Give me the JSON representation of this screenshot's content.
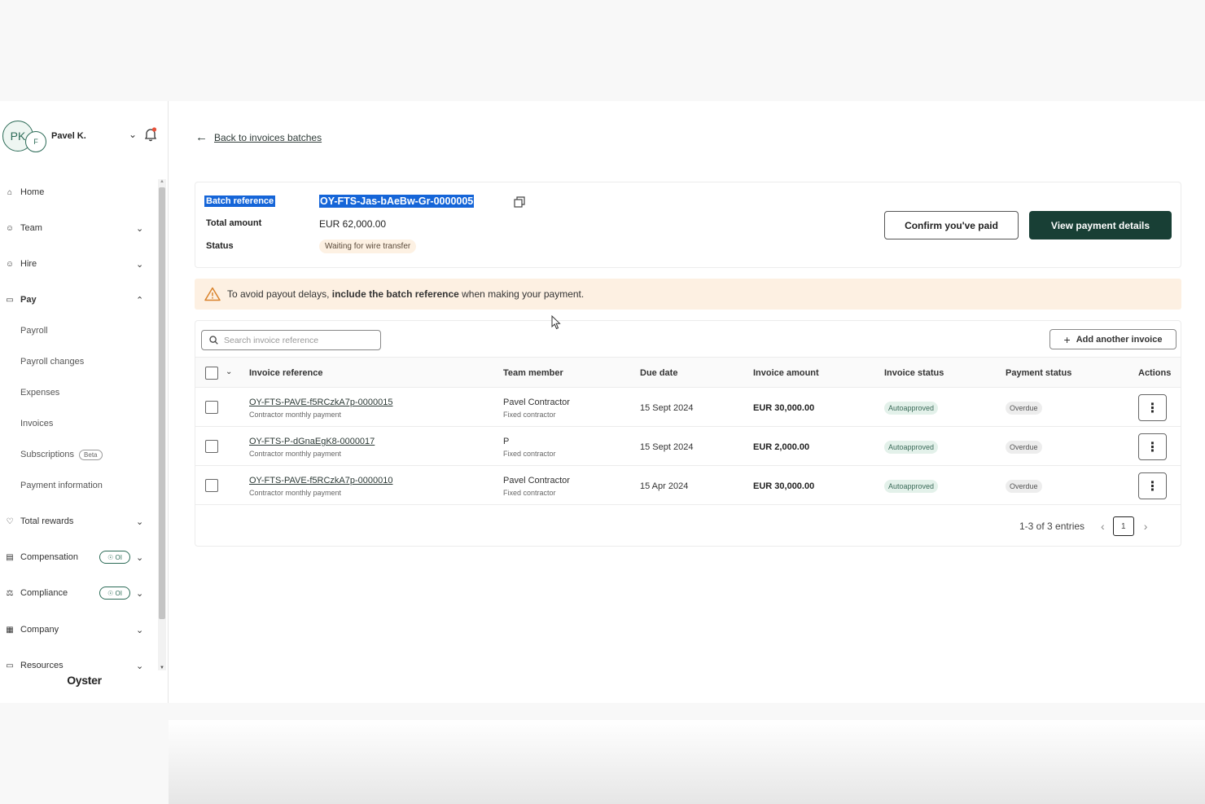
{
  "user": {
    "initials": "PK",
    "secondary_initial": "F",
    "name": "Pavel K."
  },
  "nav": {
    "items": [
      {
        "label": "Home",
        "icon": "home-icon"
      },
      {
        "label": "Team",
        "icon": "team-icon"
      },
      {
        "label": "Hire",
        "icon": "hire-icon"
      },
      {
        "label": "Pay",
        "icon": "pay-icon"
      },
      {
        "label": "Total rewards",
        "icon": "heart-icon"
      },
      {
        "label": "Compensation",
        "icon": "compensation-icon",
        "pill": "OI"
      },
      {
        "label": "Compliance",
        "icon": "scales-icon",
        "pill": "OI"
      },
      {
        "label": "Company",
        "icon": "building-icon"
      },
      {
        "label": "Resources",
        "icon": "folder-icon"
      }
    ],
    "pay_sub": [
      {
        "label": "Payroll"
      },
      {
        "label": "Payroll changes"
      },
      {
        "label": "Expenses"
      },
      {
        "label": "Invoices"
      },
      {
        "label": "Subscriptions",
        "badge": "Beta"
      },
      {
        "label": "Payment information"
      }
    ]
  },
  "brand": "Oyster",
  "back_link": "Back to invoices batches",
  "batch": {
    "ref_label": "Batch reference",
    "ref_value": "OY-FTS-Jas-bAeBw-Gr-0000005",
    "total_label": "Total amount",
    "total_value": "EUR 62,000.00",
    "status_label": "Status",
    "status_value": "Waiting for wire transfer",
    "confirm_btn": "Confirm you've paid",
    "view_btn": "View payment details"
  },
  "alert": {
    "pre": "To avoid payout delays, ",
    "bold": "include the batch reference",
    "post": " when making your payment."
  },
  "table": {
    "search_placeholder": "Search invoice reference",
    "add_btn": "Add another invoice",
    "headers": {
      "ref": "Invoice reference",
      "member": "Team member",
      "due": "Due date",
      "amount": "Invoice amount",
      "inv_status": "Invoice status",
      "pay_status": "Payment status",
      "actions": "Actions"
    },
    "rows": [
      {
        "ref": "OY-FTS-PAVE-f5RCzkA7p-0000015",
        "ref_sub": "Contractor monthly payment",
        "member": "Pavel Contractor",
        "member_sub": "Fixed contractor",
        "due": "15 Sept 2024",
        "amount": "EUR 30,000.00",
        "inv_status": "Autoapproved",
        "pay_status": "Overdue"
      },
      {
        "ref": "OY-FTS-P-dGnaEgK8-0000017",
        "ref_sub": "Contractor monthly payment",
        "member": "P",
        "member_sub": "Fixed contractor",
        "due": "15 Sept 2024",
        "amount": "EUR 2,000.00",
        "inv_status": "Autoapproved",
        "pay_status": "Overdue"
      },
      {
        "ref": "OY-FTS-PAVE-f5RCzkA7p-0000010",
        "ref_sub": "Contractor monthly payment",
        "member": "Pavel Contractor",
        "member_sub": "Fixed contractor",
        "due": "15 Apr 2024",
        "amount": "EUR 30,000.00",
        "inv_status": "Autoapproved",
        "pay_status": "Overdue"
      }
    ],
    "pagination": {
      "summary": "1-3 of 3 entries",
      "page": "1"
    }
  },
  "colors": {
    "primary": "#183f35",
    "accent": "#2c6b57",
    "selection": "#1565d8",
    "warning_bg": "#fdf0e2"
  }
}
